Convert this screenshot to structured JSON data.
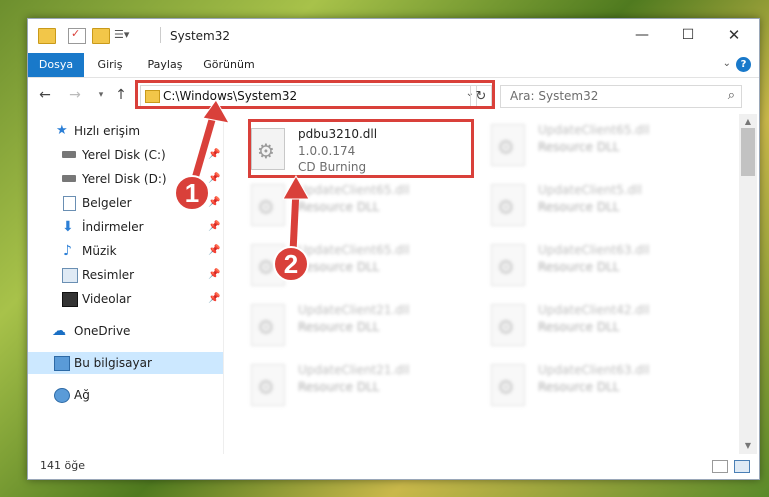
{
  "window": {
    "title": "System32"
  },
  "ribbon": {
    "tabs": [
      "Dosya",
      "Giriş",
      "Paylaş",
      "Görünüm"
    ]
  },
  "nav": {
    "address": "C:\\Windows\\System32",
    "search_placeholder": "Ara: System32"
  },
  "sidebar": {
    "items": [
      {
        "label": "Hızlı erişim",
        "icon": "star-icon",
        "pinned": false
      },
      {
        "label": "Yerel Disk (C:)",
        "icon": "drive-icon",
        "pinned": true
      },
      {
        "label": "Yerel Disk (D:)",
        "icon": "drive-icon",
        "pinned": true
      },
      {
        "label": "Belgeler",
        "icon": "documents-icon",
        "pinned": true
      },
      {
        "label": "İndirmeler",
        "icon": "downloads-icon",
        "pinned": true
      },
      {
        "label": "Müzik",
        "icon": "music-icon",
        "pinned": true
      },
      {
        "label": "Resimler",
        "icon": "pictures-icon",
        "pinned": true
      },
      {
        "label": "Videolar",
        "icon": "videos-icon",
        "pinned": true
      },
      {
        "label": "OneDrive",
        "icon": "cloud-icon",
        "pinned": false
      },
      {
        "label": "Bu bilgisayar",
        "icon": "computer-icon",
        "pinned": false
      },
      {
        "label": "Ağ",
        "icon": "network-icon",
        "pinned": false
      }
    ]
  },
  "files": [
    {
      "name": "pdbu3210.dll",
      "version": "1.0.0.174",
      "desc": "CD Burning"
    },
    {
      "name": "UpdateClient65.dll",
      "desc": "Resource DLL"
    },
    {
      "name": "UpdateClient65.dll",
      "desc": "Resource DLL"
    },
    {
      "name": "UpdateClient5.dll",
      "desc": "Resource DLL"
    },
    {
      "name": "UpdateClient65.dll",
      "desc": "Resource DLL"
    },
    {
      "name": "UpdateClient63.dll",
      "desc": "Resource DLL"
    },
    {
      "name": "UpdateClient21.dll",
      "desc": "Resource DLL"
    },
    {
      "name": "UpdateClient42.dll",
      "desc": "Resource DLL"
    },
    {
      "name": "UpdateClient21.dll",
      "desc": "Resource DLL"
    },
    {
      "name": "UpdateClient63.dll",
      "desc": "Resource DLL"
    }
  ],
  "status": {
    "count": "141 öğe"
  },
  "annotations": {
    "step1": "1",
    "step2": "2"
  },
  "colors": {
    "accent": "#1979ca",
    "highlight": "#d9403a"
  }
}
